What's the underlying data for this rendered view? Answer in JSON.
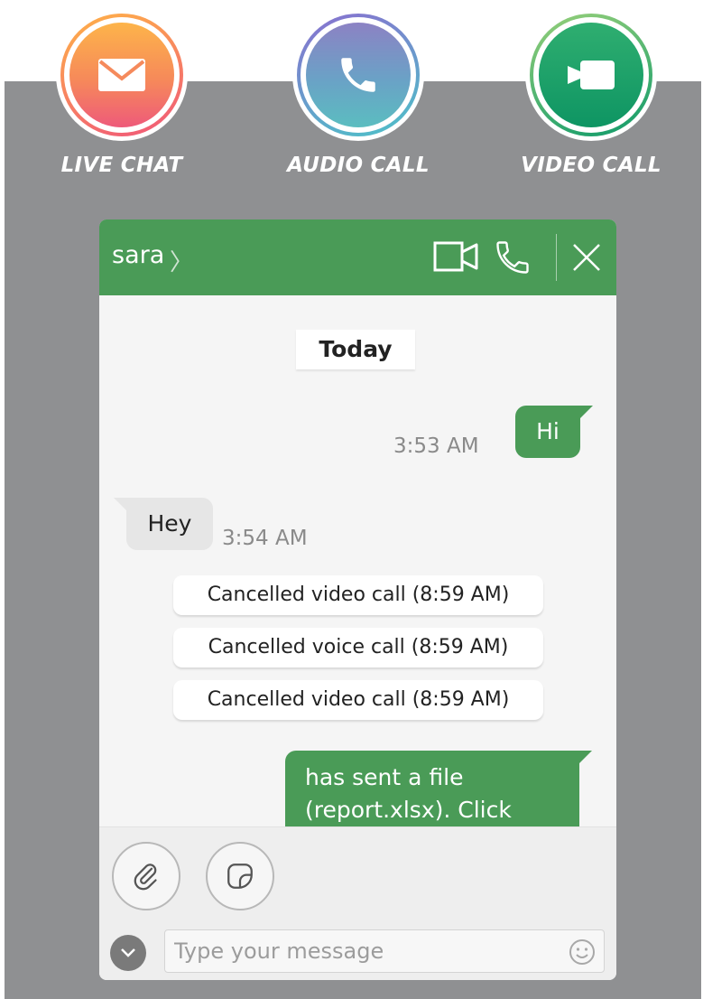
{
  "features": [
    {
      "label": "LIVE CHAT",
      "icon": "envelope-icon"
    },
    {
      "label": "AUDIO CALL",
      "icon": "phone-icon"
    },
    {
      "label": "VIDEO CALL",
      "icon": "video-camera-icon"
    }
  ],
  "chat": {
    "contact_name": "sara",
    "header_icons": [
      "video-camera-icon",
      "phone-icon",
      "close-icon"
    ],
    "date_separator": "Today",
    "messages": [
      {
        "direction": "outgoing",
        "text": "Hi",
        "time": "3:53 AM"
      },
      {
        "direction": "incoming",
        "text": "Hey",
        "time": "3:54 AM"
      }
    ],
    "system_notices": [
      "Cancelled video call (8:59 AM)",
      "Cancelled voice call (8:59 AM)",
      "Cancelled video call (8:59 AM)"
    ],
    "file_message": {
      "line1": "has sent a file",
      "line2": "(report.xlsx). Click"
    },
    "toolbar_icons": [
      "paperclip-icon",
      "sticker-icon"
    ],
    "input": {
      "placeholder": "Type your message",
      "value": ""
    }
  },
  "colors": {
    "header_green": "#4a9b57",
    "backdrop_grey": "#8f9092",
    "outgoing_bubble": "#4a9b57",
    "incoming_bubble": "#e6e6e6"
  }
}
